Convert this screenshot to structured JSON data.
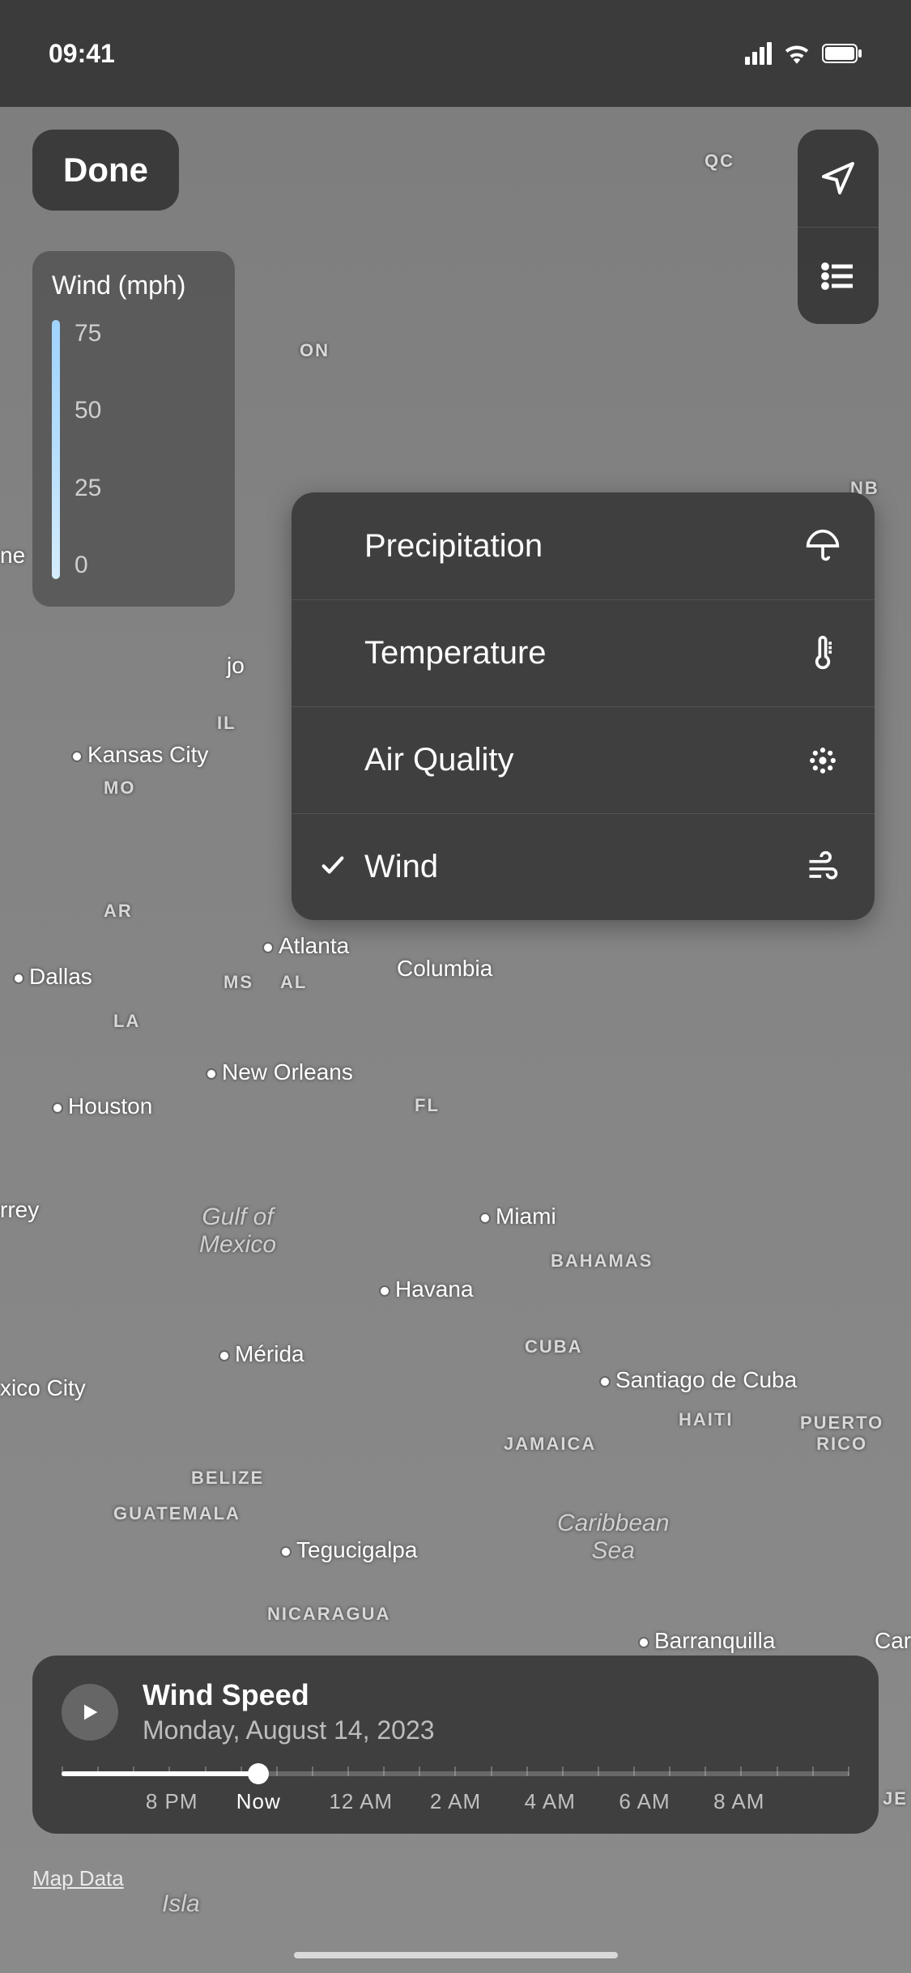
{
  "status_bar": {
    "time": "09:41"
  },
  "done_label": "Done",
  "legend": {
    "title": "Wind (mph)",
    "ticks": [
      "75",
      "50",
      "25",
      "0"
    ]
  },
  "layer_menu": {
    "items": [
      {
        "label": "Precipitation",
        "icon": "umbrella-icon",
        "selected": false
      },
      {
        "label": "Temperature",
        "icon": "thermometer-icon",
        "selected": false
      },
      {
        "label": "Air Quality",
        "icon": "particles-icon",
        "selected": false
      },
      {
        "label": "Wind",
        "icon": "wind-icon",
        "selected": true
      }
    ]
  },
  "map_labels": {
    "qc": "QC",
    "on": "ON",
    "nb": "NB",
    "ne_frag": "ne",
    "kansas_city": "Kansas City",
    "il": "IL",
    "mo": "MO",
    "ar": "AR",
    "dallas": "Dallas",
    "ms": "MS",
    "al": "AL",
    "la": "LA",
    "atlanta": "Atlanta",
    "columbia": "Columbia",
    "new_orleans": "New Orleans",
    "fl": "FL",
    "houston": "Houston",
    "rrey": "rrey",
    "gulf_of_mexico": "Gulf of\nMexico",
    "miami": "Miami",
    "bahamas": "BAHAMAS",
    "havana": "Havana",
    "merida": "Mérida",
    "cuba": "CUBA",
    "santiago": "Santiago de Cuba",
    "haiti": "HAITI",
    "puerto_rico": "PUERTO\nRICO",
    "xico_city": "xico City",
    "jamaica": "JAMAICA",
    "belize": "BELIZE",
    "guatemala": "GUATEMALA",
    "tegucigalpa": "Tegucigalpa",
    "caribbean_sea": "Caribbean\nSea",
    "nicaragua": "NICARAGUA",
    "barranquilla": "Barranquilla",
    "car_frag": "Car",
    "je_frag": "JE",
    "isla": "Isla",
    "jo": "jo"
  },
  "timeline": {
    "title": "Wind Speed",
    "date": "Monday, August 14, 2023",
    "progress_percent": 25,
    "labels": [
      {
        "text": "8 PM",
        "pos": 14
      },
      {
        "text": "Now",
        "pos": 25
      },
      {
        "text": "12 AM",
        "pos": 38
      },
      {
        "text": "2 AM",
        "pos": 50
      },
      {
        "text": "4 AM",
        "pos": 62
      },
      {
        "text": "6 AM",
        "pos": 74
      },
      {
        "text": "8 AM",
        "pos": 86
      }
    ]
  },
  "map_data_label": "Map Data"
}
